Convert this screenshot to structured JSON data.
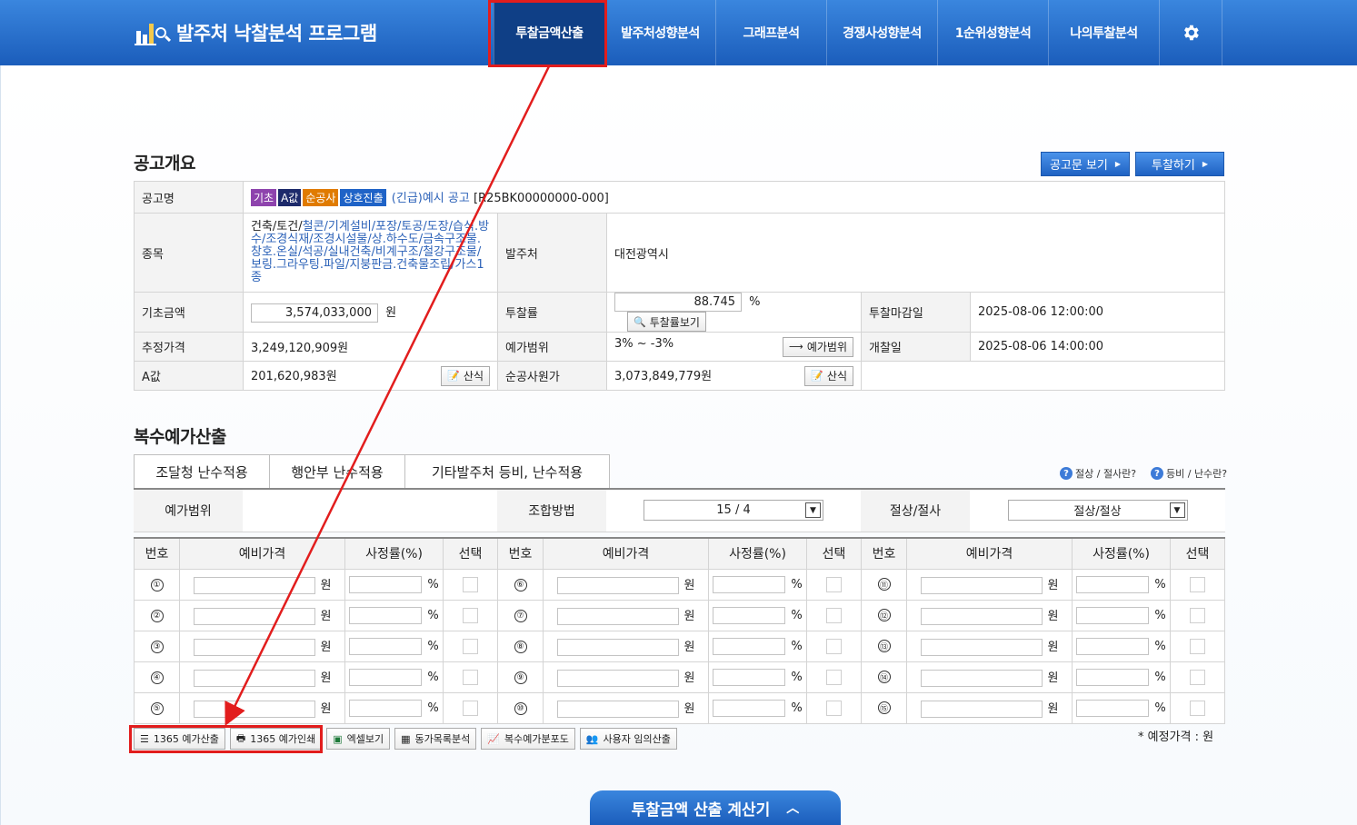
{
  "app": {
    "title": "발주처 낙찰분석 프로그램"
  },
  "nav": {
    "items": [
      "투찰금액산출",
      "발주처성향분석",
      "그래프분석",
      "경쟁사성향분석",
      "1순위성향분석",
      "나의투찰분석"
    ],
    "settings_icon": "gear-icon"
  },
  "notice": {
    "section_title": "공고개요",
    "view_notice_button": "공고문 보기",
    "bid_button": "투찰하기",
    "labels": {
      "name": "공고명",
      "category": "종목",
      "owner": "발주처",
      "base_amount": "기초금액",
      "bid_rate": "투찰률",
      "deadline": "투찰마감일",
      "estimated_price": "추정가격",
      "price_range": "예가범위",
      "opening": "개찰일",
      "a_value": "A값",
      "net_cost": "순공사원가"
    },
    "tags": [
      {
        "text": "기초",
        "color": "#8e44ad"
      },
      {
        "text": "A값",
        "color": "#1d2a6b"
      },
      {
        "text": "순공사",
        "color": "#e07b00"
      },
      {
        "text": "상호진출",
        "color": "#1f63c7"
      }
    ],
    "title_link": "(긴급)예시 공고",
    "notice_id": "[R25BK00000000-000]",
    "category_main": "건축/토건/",
    "category_detail": "철콘/기계설비/포장/토공/도장/습식.방수/조경식재/조경시설물/상.하수도/금속구조물.창호.온실/석공/실내건축/비계구조/철강구조물/보링.그라우팅.파일/지붕판금.건축물조립/가스1종",
    "owner_value": "대전광역시",
    "base_amount_value": "3,574,033,000",
    "won": "원",
    "bid_rate_value": "88.745",
    "percent": "%",
    "bid_rate_button": "투찰률보기",
    "deadline_value": "2025-08-06 12:00:00",
    "estimated_price_value": "3,249,120,909원",
    "price_range_value": "3% ~ -3%",
    "price_range_button": "예가범위",
    "opening_value": "2025-08-06 14:00:00",
    "a_value_value": "201,620,983원",
    "calc_button": "산식",
    "net_cost_value": "3,073,849,779원"
  },
  "multi": {
    "section_title": "복수예가산출",
    "tabs": [
      "조달청 난수적용",
      "행안부 난수적용",
      "기타발주처 등비, 난수적용"
    ],
    "help_links": [
      "절상 / 절사란?",
      "등비 / 난수란?"
    ],
    "option_labels": {
      "range": "예가범위",
      "combine": "조합방법",
      "round": "절상/절사"
    },
    "combine_value": "15 / 4",
    "round_value": "절상/절상",
    "columns": [
      "번호",
      "예비가격",
      "사정률(%)",
      "선택"
    ],
    "rows": [
      [
        "①",
        "⑥",
        "⑪"
      ],
      [
        "②",
        "⑦",
        "⑫"
      ],
      [
        "③",
        "⑧",
        "⑬"
      ],
      [
        "④",
        "⑨",
        "⑭"
      ],
      [
        "⑤",
        "⑩",
        "⑮"
      ]
    ],
    "unit_won": "원",
    "unit_pct": "%"
  },
  "tools": [
    "1365 예가산출",
    "1365 예가인쇄",
    "엑셀보기",
    "동가목록분석",
    "복수예가분포도",
    "사용자 임의산출"
  ],
  "note": "* 예정가격 : 원",
  "calculator_tab": "투찰금액 산출 계산기"
}
